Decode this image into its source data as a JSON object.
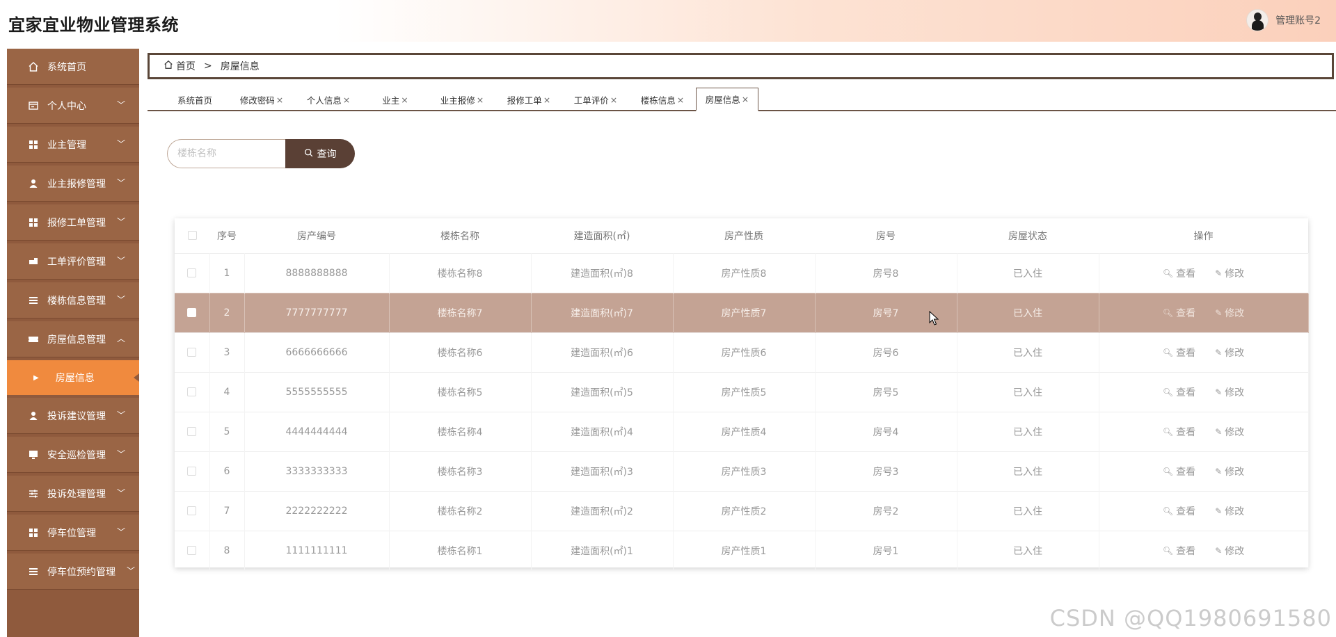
{
  "app": {
    "title": "宜家宜业物业管理系统",
    "user_name": "管理账号2"
  },
  "sidebar": {
    "items": [
      {
        "label": "系统首页",
        "icon": "home-icon",
        "chevron": ""
      },
      {
        "label": "个人中心",
        "icon": "card-icon",
        "chevron": "﹀"
      },
      {
        "label": "业主管理",
        "icon": "grid-icon",
        "chevron": "﹀"
      },
      {
        "label": "业主报修管理",
        "icon": "user-icon",
        "chevron": "﹀"
      },
      {
        "label": "报修工单管理",
        "icon": "grid-icon",
        "chevron": "﹀"
      },
      {
        "label": "工单评价管理",
        "icon": "comment-icon",
        "chevron": "﹀"
      },
      {
        "label": "楼栋信息管理",
        "icon": "list-icon",
        "chevron": "﹀"
      },
      {
        "label": "房屋信息管理",
        "icon": "ticket-icon",
        "chevron": "︿"
      },
      {
        "label": "投诉建议管理",
        "icon": "user-icon",
        "chevron": "﹀"
      },
      {
        "label": "安全巡检管理",
        "icon": "monitor-icon",
        "chevron": "﹀"
      },
      {
        "label": "投诉处理管理",
        "icon": "sliders-icon",
        "chevron": "﹀"
      },
      {
        "label": "停车位管理",
        "icon": "grid-icon",
        "chevron": "﹀"
      },
      {
        "label": "停车位预约管理",
        "icon": "menu-icon",
        "chevron": "﹀"
      }
    ],
    "active_sub": "房屋信息"
  },
  "breadcrumb": {
    "home": "首页",
    "separator": ">",
    "current": "房屋信息"
  },
  "tabs": [
    {
      "label": "系统首页",
      "close": ""
    },
    {
      "label": "修改密码",
      "close": "×"
    },
    {
      "label": "个人信息",
      "close": "×"
    },
    {
      "label": "业主",
      "close": "×"
    },
    {
      "label": "业主报修",
      "close": "×"
    },
    {
      "label": "报修工单",
      "close": "×"
    },
    {
      "label": "工单评价",
      "close": "×"
    },
    {
      "label": "楼栋信息",
      "close": "×"
    },
    {
      "label": "房屋信息",
      "close": "×"
    }
  ],
  "search": {
    "placeholder": "楼栋名称",
    "button_label": "查询"
  },
  "table": {
    "columns": [
      "序号",
      "房产编号",
      "楼栋名称",
      "建造面积(㎡)",
      "房产性质",
      "房号",
      "房屋状态",
      "操作"
    ],
    "view_label": "查看",
    "edit_label": "修改",
    "rows": [
      [
        "1",
        "8888888888",
        "楼栋名称8",
        "建造面积(㎡)8",
        "房产性质8",
        "房号8",
        "已入住"
      ],
      [
        "2",
        "7777777777",
        "楼栋名称7",
        "建造面积(㎡)7",
        "房产性质7",
        "房号7",
        "已入住"
      ],
      [
        "3",
        "6666666666",
        "楼栋名称6",
        "建造面积(㎡)6",
        "房产性质6",
        "房号6",
        "已入住"
      ],
      [
        "4",
        "5555555555",
        "楼栋名称5",
        "建造面积(㎡)5",
        "房产性质5",
        "房号5",
        "已入住"
      ],
      [
        "5",
        "4444444444",
        "楼栋名称4",
        "建造面积(㎡)4",
        "房产性质4",
        "房号4",
        "已入住"
      ],
      [
        "6",
        "3333333333",
        "楼栋名称3",
        "建造面积(㎡)3",
        "房产性质3",
        "房号3",
        "已入住"
      ],
      [
        "7",
        "2222222222",
        "楼栋名称2",
        "建造面积(㎡)2",
        "房产性质2",
        "房号2",
        "已入住"
      ],
      [
        "8",
        "1111111111",
        "楼栋名称1",
        "建造面积(㎡)1",
        "房产性质1",
        "房号1",
        "已入住"
      ]
    ],
    "highlighted_row": 2
  },
  "watermark": "CSDN @QQ1980691580"
}
